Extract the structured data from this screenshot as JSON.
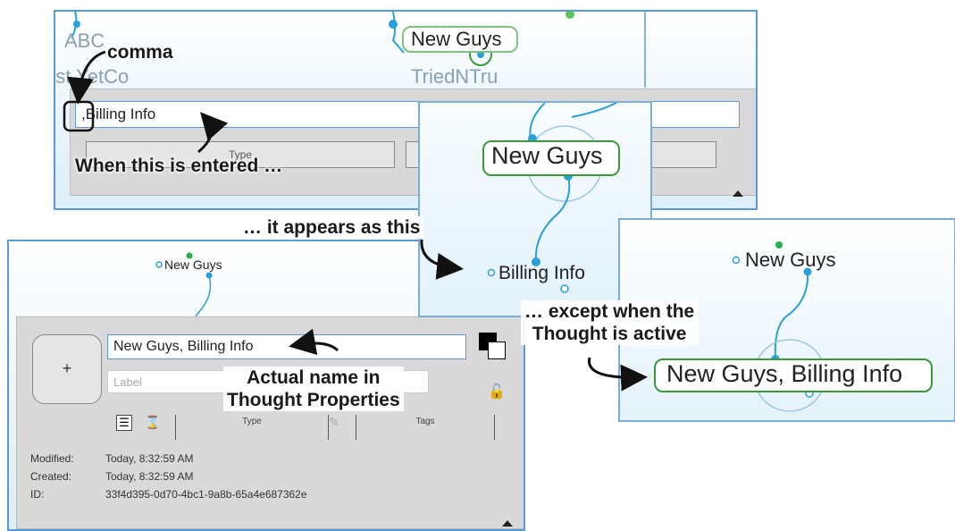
{
  "panel_top": {
    "nodes": [
      "ABC",
      "New Guys",
      "est YetCo",
      "TriedNTru"
    ],
    "name_field_value": ",Billing Info",
    "type_placeholder": "Type"
  },
  "panel_zoom": {
    "parent": "New Guys",
    "child": "Billing Info"
  },
  "panel_active": {
    "parent": "New Guys",
    "active": "New Guys, Billing Info"
  },
  "panel_props": {
    "node": "New Guys",
    "add_button": "+",
    "name_field_value": "New Guys, Billing Info",
    "label_placeholder": "Label",
    "type_label": "Type",
    "tags_label": "Tags",
    "meta": [
      {
        "key": "Modified:",
        "value": "Today, 8:32:59 AM"
      },
      {
        "key": "Created:",
        "value": "Today, 8:32:59 AM"
      },
      {
        "key": "ID:",
        "value": "33f4d395-0d70-4bc1-9a8b-65a4e687362e"
      }
    ]
  },
  "callouts": {
    "comma": "comma",
    "entered": "When this is entered …",
    "appears": "… it appears as this",
    "except": "… except when the\nThought is active",
    "actual": "Actual name in\nThought Properties"
  },
  "colors": {
    "accent_blue": "#5b9bd5",
    "link_blue": "#2aa0d8",
    "active_green": "#3a9a3a",
    "gray_panel": "#d9d9d9"
  }
}
